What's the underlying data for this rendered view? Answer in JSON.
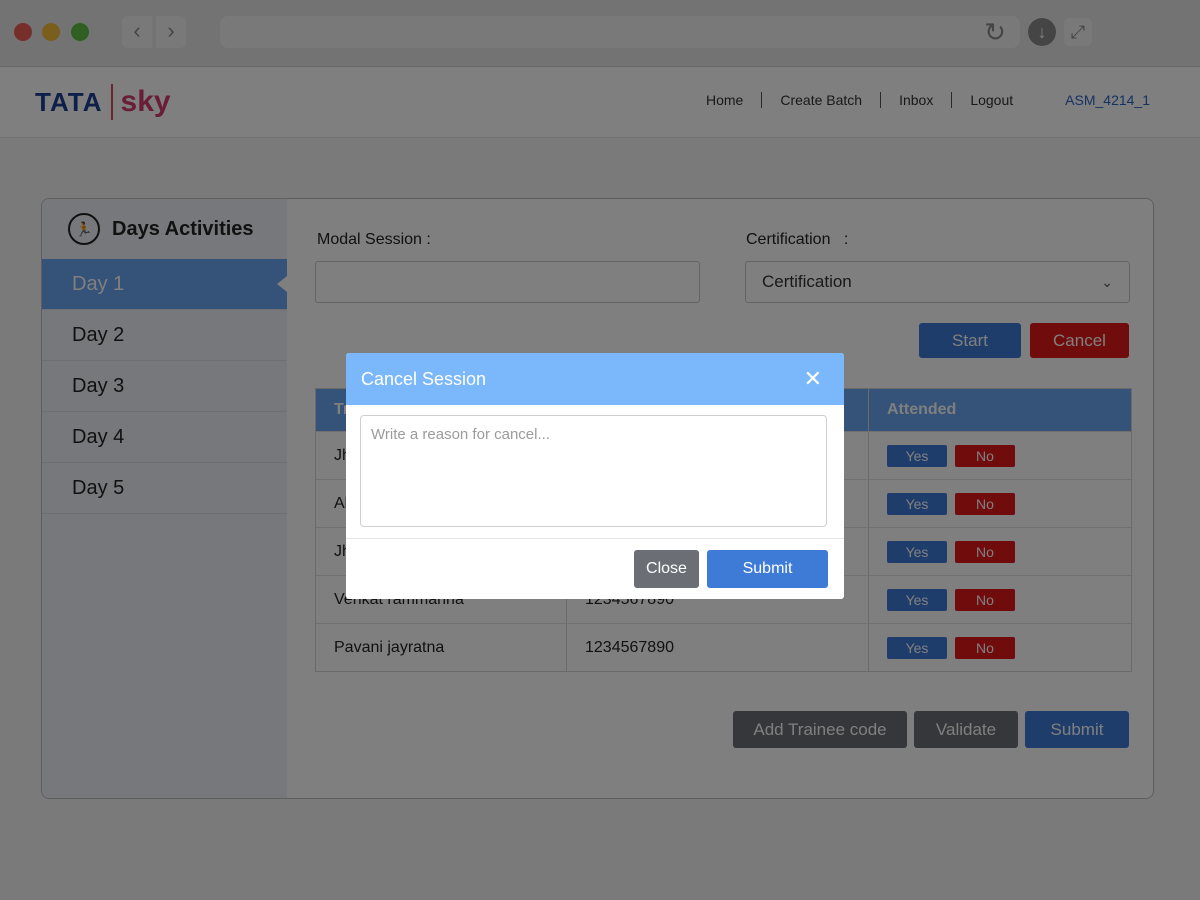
{
  "browser": {
    "back_glyph": "‹",
    "forward_glyph": "›",
    "reload_glyph": "↻",
    "download_glyph": "↓",
    "expand_glyph": "⤢"
  },
  "header": {
    "logo_left": "TATA",
    "logo_right": "sky",
    "nav": [
      "Home",
      "Create Batch",
      "Inbox",
      "Logout"
    ],
    "user": "ASM_4214_1"
  },
  "sidebar": {
    "title": "Days Activities",
    "icon": "runner-icon",
    "days": [
      "Day 1",
      "Day 2",
      "Day 3",
      "Day 4",
      "Day 5"
    ],
    "active_index": 0
  },
  "form": {
    "modal_session_label": "Modal Session :",
    "modal_session_value": "",
    "certification_label": "Certification   :",
    "certification_selected": "Certification",
    "start_label": "Start",
    "cancel_label": "Cancel"
  },
  "table": {
    "columns": [
      "Tr",
      "",
      "Attended"
    ],
    "rows": [
      {
        "name": "Jh",
        "phone": ""
      },
      {
        "name": "Al",
        "phone": ""
      },
      {
        "name": "Jh",
        "phone": ""
      },
      {
        "name": "Venkat rammanna",
        "phone": "1234567890"
      },
      {
        "name": "Pavani jayratna",
        "phone": "1234567890"
      }
    ],
    "yes_label": "Yes",
    "no_label": "No"
  },
  "actions": {
    "add_trainee": "Add Trainee code",
    "validate": "Validate",
    "submit": "Submit"
  },
  "modal": {
    "title": "Cancel Session",
    "close_glyph": "✕",
    "reason_placeholder": "Write a reason for cancel...",
    "close_label": "Close",
    "submit_label": "Submit"
  },
  "colors": {
    "accent_blue": "#3e7bd6",
    "header_blue": "#6aa5f2",
    "danger_red": "#e01818",
    "modal_header": "#7ab7fb"
  }
}
